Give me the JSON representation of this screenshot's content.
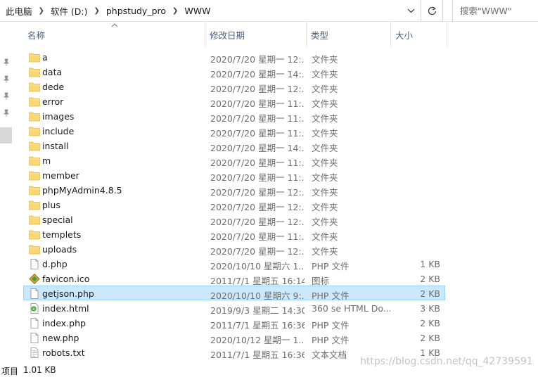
{
  "address": {
    "crumbs": [
      "此电脑",
      "软件 (D:)",
      "phpstudy_pro",
      "WWW"
    ]
  },
  "search": {
    "placeholder": "搜索\"WWW\""
  },
  "columns": {
    "name": "名称",
    "date": "修改日期",
    "type": "类型",
    "size": "大小"
  },
  "files": [
    {
      "name": "a",
      "date": "2020/7/20 星期一 12:...",
      "type": "文件夹",
      "size": "",
      "icon": "folder-icon"
    },
    {
      "name": "data",
      "date": "2020/7/20 星期一 14:...",
      "type": "文件夹",
      "size": "",
      "icon": "folder-icon"
    },
    {
      "name": "dede",
      "date": "2020/7/20 星期一 12:...",
      "type": "文件夹",
      "size": "",
      "icon": "folder-icon"
    },
    {
      "name": "error",
      "date": "2020/7/20 星期一 11:...",
      "type": "文件夹",
      "size": "",
      "icon": "folder-icon"
    },
    {
      "name": "images",
      "date": "2020/7/20 星期一 11:...",
      "type": "文件夹",
      "size": "",
      "icon": "folder-icon"
    },
    {
      "name": "include",
      "date": "2020/7/20 星期一 11:...",
      "type": "文件夹",
      "size": "",
      "icon": "folder-icon"
    },
    {
      "name": "install",
      "date": "2020/7/20 星期一 14:...",
      "type": "文件夹",
      "size": "",
      "icon": "folder-icon"
    },
    {
      "name": "m",
      "date": "2020/7/20 星期一 11:...",
      "type": "文件夹",
      "size": "",
      "icon": "folder-icon"
    },
    {
      "name": "member",
      "date": "2020/7/20 星期一 11:...",
      "type": "文件夹",
      "size": "",
      "icon": "folder-icon"
    },
    {
      "name": "phpMyAdmin4.8.5",
      "date": "2020/7/20 星期一 12:...",
      "type": "文件夹",
      "size": "",
      "icon": "folder-icon"
    },
    {
      "name": "plus",
      "date": "2020/7/20 星期一 12:...",
      "type": "文件夹",
      "size": "",
      "icon": "folder-icon"
    },
    {
      "name": "special",
      "date": "2020/7/20 星期一 12:...",
      "type": "文件夹",
      "size": "",
      "icon": "folder-icon"
    },
    {
      "name": "templets",
      "date": "2020/7/20 星期一 11:...",
      "type": "文件夹",
      "size": "",
      "icon": "folder-icon"
    },
    {
      "name": "uploads",
      "date": "2020/7/20 星期一 12:...",
      "type": "文件夹",
      "size": "",
      "icon": "folder-icon"
    },
    {
      "name": "d.php",
      "date": "2020/10/10 星期六 1...",
      "type": "PHP 文件",
      "size": "1 KB",
      "icon": "file-icon"
    },
    {
      "name": "favicon.ico",
      "date": "2011/7/1 星期五 16:14",
      "type": "图标",
      "size": "2 KB",
      "icon": "ico-file-icon"
    },
    {
      "name": "getjson.php",
      "date": "2020/10/10 星期六 9:...",
      "type": "PHP 文件",
      "size": "2 KB",
      "icon": "file-icon",
      "selected": true
    },
    {
      "name": "index.html",
      "date": "2019/9/3 星期二 14:30",
      "type": "360 se HTML Do...",
      "size": "3 KB",
      "icon": "html-file-icon"
    },
    {
      "name": "index.php",
      "date": "2011/7/1 星期五 16:36",
      "type": "PHP 文件",
      "size": "2 KB",
      "icon": "file-icon"
    },
    {
      "name": "new.php",
      "date": "2020/10/12 星期一 1...",
      "type": "PHP 文件",
      "size": "2 KB",
      "icon": "file-icon"
    },
    {
      "name": "robots.txt",
      "date": "2011/7/1 星期五 16:36",
      "type": "文本文档",
      "size": "1 KB",
      "icon": "text-file-icon"
    }
  ],
  "status": {
    "items_label": "项目",
    "size": "1.01 KB"
  },
  "watermark": "https://blog.csdn.net/qq_42739591",
  "colors": {
    "folder": "#f8d775",
    "selection": "#cce8ff",
    "selection_border": "#99d1ff",
    "header_text": "#4c607a"
  }
}
